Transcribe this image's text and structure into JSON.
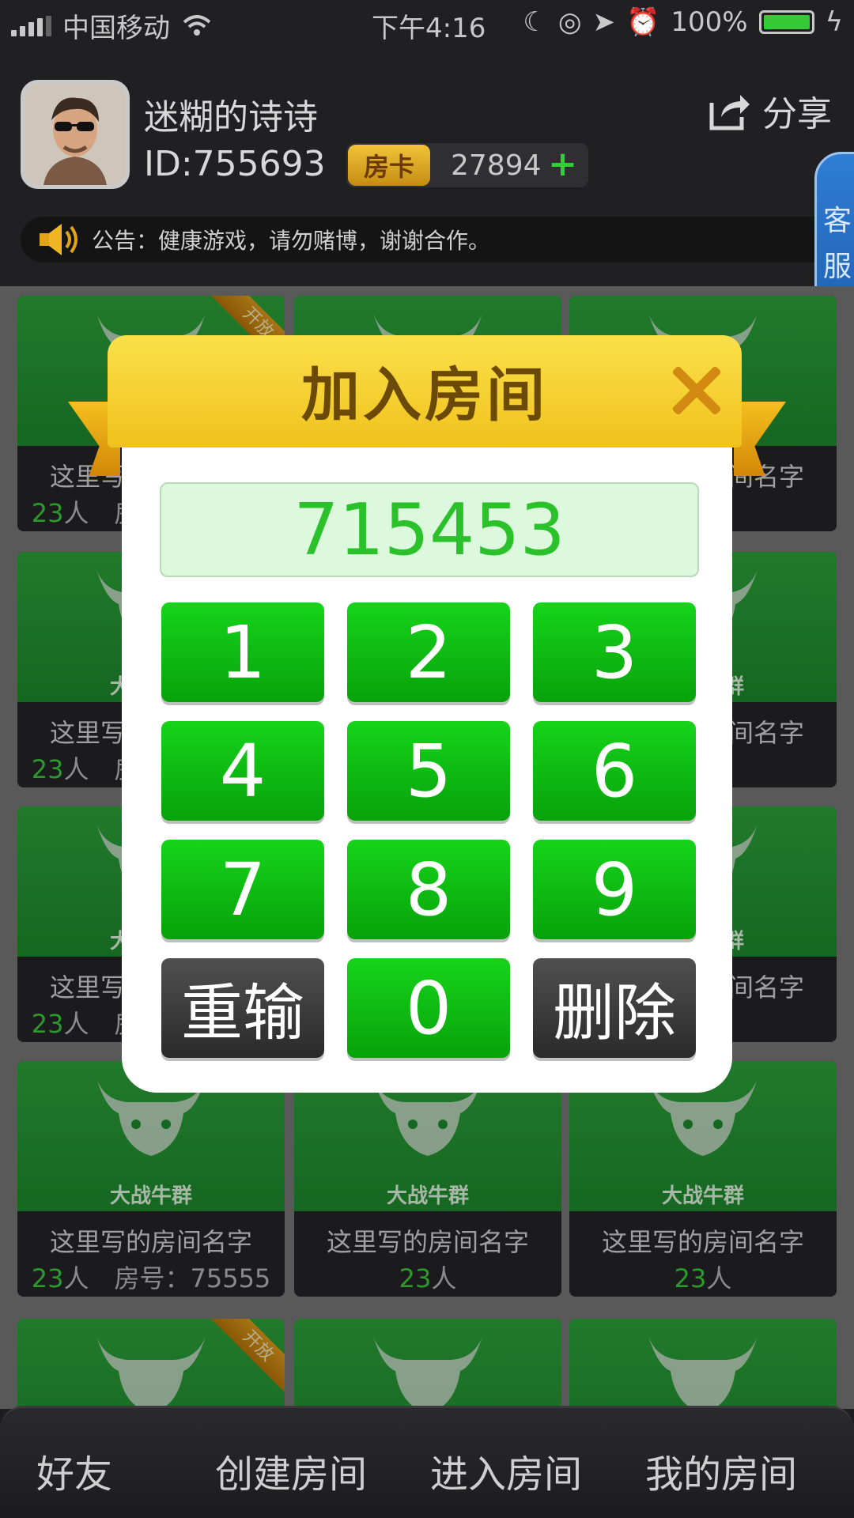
{
  "status_bar": {
    "carrier": "中国移动",
    "time": "下午4:16",
    "battery": "100%"
  },
  "user": {
    "name": "迷糊的诗诗",
    "id": "ID:755693",
    "card_label": "房卡",
    "card_count": "27894",
    "card_add": "+"
  },
  "share_label": "分享",
  "notice": "公告：健康游戏，请勿赌博，谢谢合作。",
  "kefu": [
    "客",
    "服"
  ],
  "rooms": {
    "game_name": "大战牛群",
    "open_ribbon": "开放",
    "room_name": "这里写的房间名字",
    "players": "23",
    "players_unit": "人",
    "room_no_label": "房号：",
    "room_no": "75555"
  },
  "modal": {
    "title": "加入房间",
    "entered": "715453",
    "keys": [
      "1",
      "2",
      "3",
      "4",
      "5",
      "6",
      "7",
      "8",
      "9",
      "重输",
      "0",
      "删除"
    ]
  },
  "tabs": [
    "好友",
    "创建房间",
    "进入房间",
    "我的房间"
  ],
  "colors": {
    "accent_green": "#07a20a",
    "gold": "#f0c21c",
    "kefu_blue": "#2f7dd5"
  }
}
